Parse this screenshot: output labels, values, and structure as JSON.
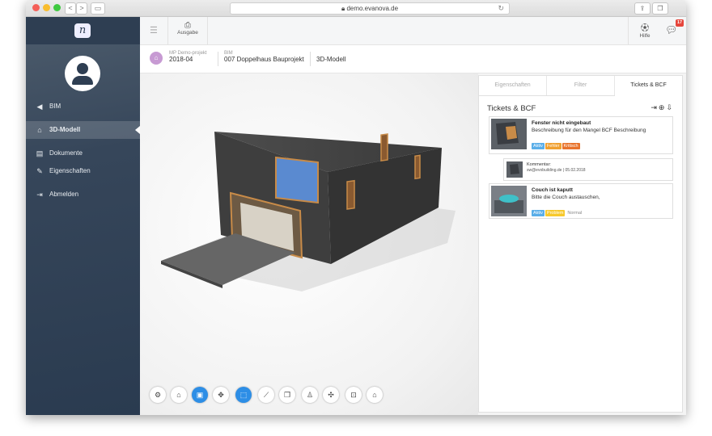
{
  "browser": {
    "url": "demo.evanova.de",
    "back": "<",
    "forward": ">"
  },
  "sidebar": {
    "logo": "n",
    "items": [
      {
        "label": "BIM",
        "icon": "◀"
      },
      {
        "label": "3D-Modell",
        "icon": "⌂"
      },
      {
        "label": "Dokumente",
        "icon": "▤"
      },
      {
        "label": "Eigenschaften",
        "icon": "✎"
      },
      {
        "label": "Abmelden",
        "icon": "⇥"
      }
    ]
  },
  "topbar": {
    "ausgabe_label": "Ausgabe",
    "hilfe_label": "Hilfe",
    "notification_count": "17"
  },
  "breadcrumb": {
    "project_small": "MP Demo-projekt",
    "project_main": "2018-04",
    "bim_small": "BIM",
    "bim_main": "007 Doppelhaus Bauprojekt",
    "view_main": "3D-Modell"
  },
  "panel": {
    "tabs": [
      "Eigenschaften",
      "Filter",
      "Tickets & BCF"
    ],
    "title": "Tickets & BCF",
    "tickets": [
      {
        "title": "Fenster nicht eingebaut",
        "description": "Beschreibung für den Mangel BCF Beschreibung",
        "tags": [
          "Aktiv",
          "Fehler",
          "Kritisch"
        ]
      },
      {
        "title": "Couch ist kaputt",
        "description": "Bitte die Couch austauschen,",
        "tags": [
          "Aktiv",
          "Problem",
          "Normal"
        ]
      }
    ],
    "comment": {
      "title": "Kommentar:",
      "meta": "sw@evobuilding.de | 05.02.2018"
    }
  },
  "colors": {
    "accent": "#2d8ee6",
    "tag_aktiv": "#5aaee8",
    "tag_fehler": "#f0a030",
    "tag_kritisch": "#e8732c",
    "tag_problem": "#f7c92c"
  },
  "toolbar_icons": [
    "gear-icon",
    "home-layer-icon",
    "save-icon",
    "compass-icon",
    "section-box-icon",
    "measure-icon",
    "cube-icon",
    "walk-person-icon",
    "explode-icon",
    "fit-icon",
    "home-icon"
  ]
}
